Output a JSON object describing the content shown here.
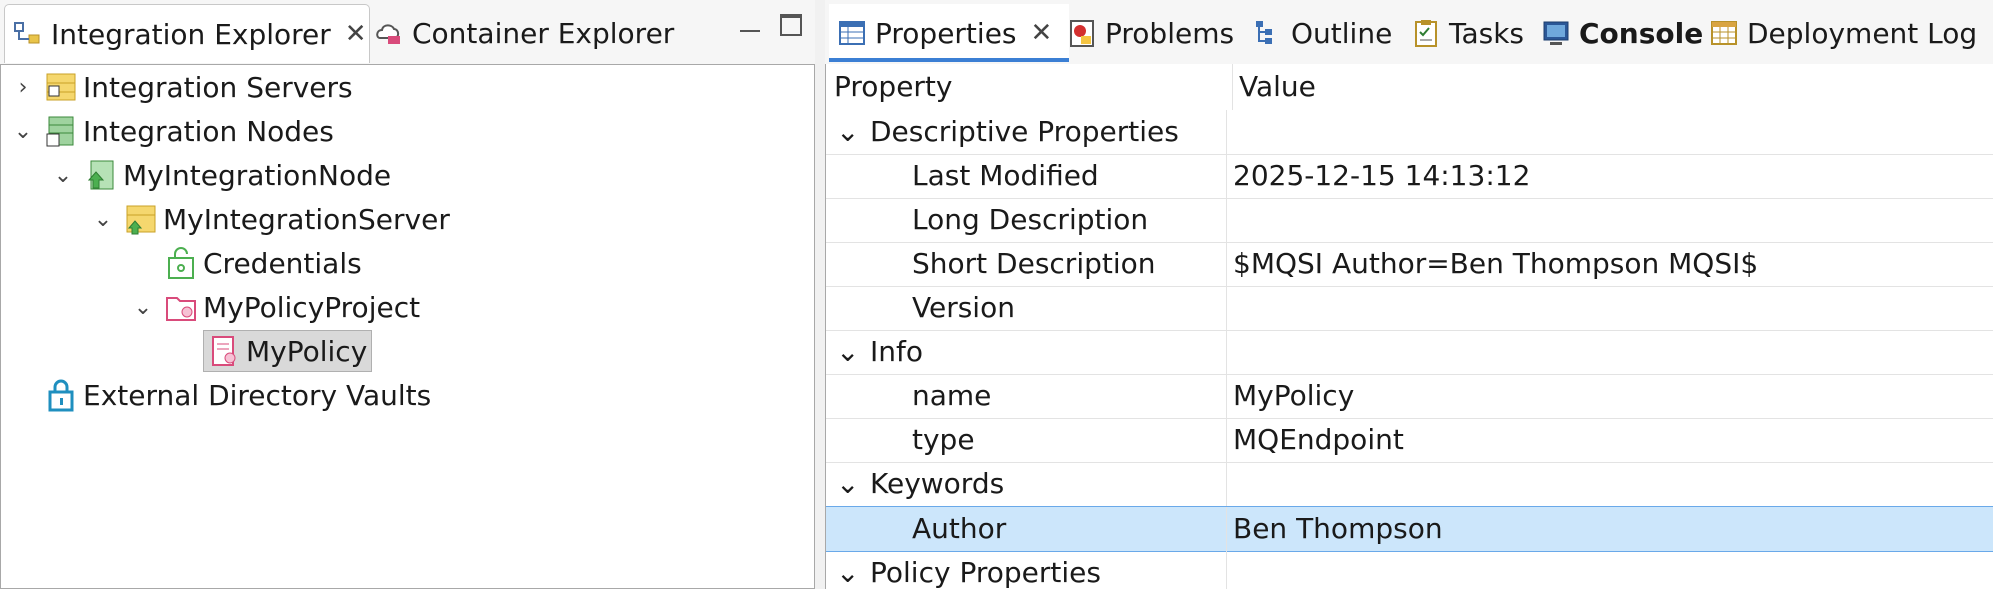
{
  "left_pane": {
    "tabs": [
      {
        "label": "Integration Explorer",
        "icon": "integration-explorer-icon",
        "active": true
      },
      {
        "label": "Container Explorer",
        "icon": "container-explorer-icon",
        "active": false
      }
    ],
    "close_glyph": "✕",
    "tree": [
      {
        "label": "Integration Servers",
        "icon": "integration-servers-icon",
        "expanded": false
      },
      {
        "label": "Integration Nodes",
        "icon": "integration-nodes-icon",
        "expanded": true
      },
      {
        "label": "MyIntegrationNode",
        "icon": "integration-node-icon",
        "expanded": true
      },
      {
        "label": "MyIntegrationServer",
        "icon": "integration-server-icon",
        "expanded": true
      },
      {
        "label": "Credentials",
        "icon": "credentials-icon"
      },
      {
        "label": "MyPolicyProject",
        "icon": "policy-project-icon",
        "expanded": true
      },
      {
        "label": "MyPolicy",
        "icon": "policy-icon",
        "selected": true
      },
      {
        "label": "External Directory Vaults",
        "icon": "lock-icon"
      }
    ]
  },
  "right_pane": {
    "tabs": [
      {
        "label": "Properties",
        "icon": "properties-icon",
        "active": true
      },
      {
        "label": "Problems",
        "icon": "problems-icon"
      },
      {
        "label": "Outline",
        "icon": "outline-icon"
      },
      {
        "label": "Tasks",
        "icon": "tasks-icon"
      },
      {
        "label": "Console",
        "icon": "console-icon",
        "bold": true
      },
      {
        "label": "Deployment Log",
        "icon": "deployment-log-icon"
      }
    ],
    "close_glyph": "✕",
    "columns": {
      "property": "Property",
      "value": "Value"
    },
    "rows": [
      {
        "property": "Descriptive Properties",
        "value": "",
        "group": true
      },
      {
        "property": "Last Modified",
        "value": "2025-12-15 14:13:12"
      },
      {
        "property": "Long Description",
        "value": ""
      },
      {
        "property": "Short Description",
        "value": "$MQSI Author=Ben Thompson MQSI$"
      },
      {
        "property": "Version",
        "value": ""
      },
      {
        "property": "Info",
        "value": "",
        "group": true
      },
      {
        "property": "name",
        "value": "MyPolicy"
      },
      {
        "property": "type",
        "value": "MQEndpoint"
      },
      {
        "property": "Keywords",
        "value": "",
        "group": true
      },
      {
        "property": "Author",
        "value": "Ben Thompson",
        "selected": true
      },
      {
        "property": "Policy Properties",
        "value": "",
        "group": true
      }
    ]
  },
  "colors": {
    "accent": "#3b7fd4",
    "selection": "#cce6fb",
    "tree_selection": "#d9d9d9"
  }
}
